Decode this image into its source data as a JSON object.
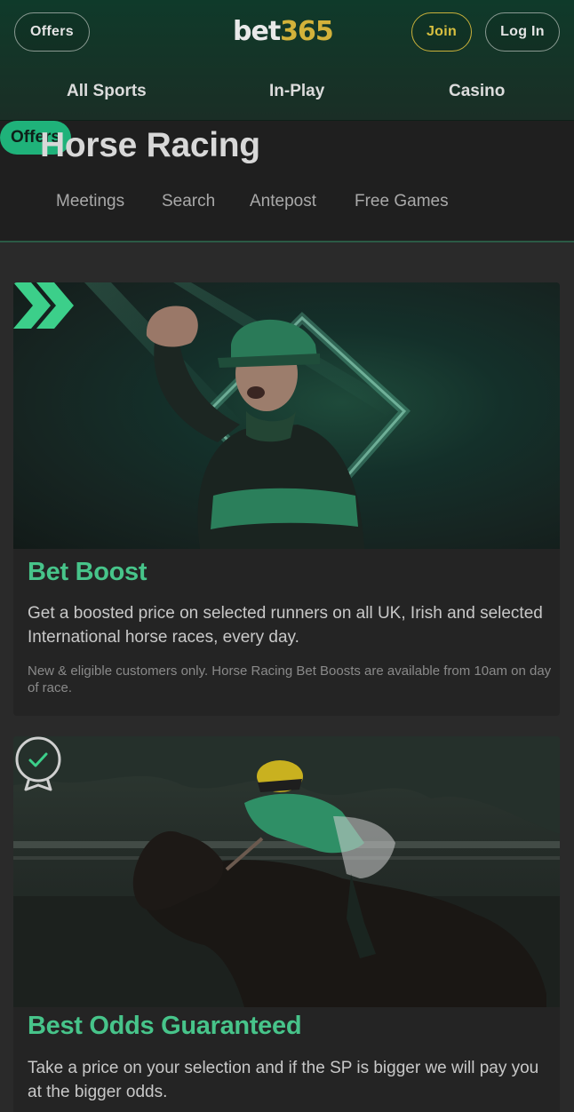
{
  "header": {
    "offers_label": "Offers",
    "logo_part1": "bet",
    "logo_part2": "365",
    "join_label": "Join",
    "login_label": "Log In",
    "nav": [
      "All Sports",
      "In-Play",
      "Casino"
    ]
  },
  "subheader": {
    "title": "Horse Racing",
    "tabs": [
      "Meetings",
      "Search",
      "Antepost",
      "Free Games",
      "Offers"
    ],
    "active_tab": "Offers"
  },
  "offers": [
    {
      "title": "Bet Boost",
      "description": "Get a boosted price on selected runners on all UK, Irish and selected International horse races, every day.",
      "terms": "New & eligible customers only. Horse Racing Bet Boosts are available from 10am on day of race.",
      "icon": "double-chevron-right-icon"
    },
    {
      "title": "Best Odds Guaranteed",
      "description": "Take a price on your selection and if the SP is bigger we will pay you at the bigger odds.",
      "icon": "badge-check-icon"
    }
  ],
  "colors": {
    "accent_green": "#1fb27a",
    "title_green": "#47c48a",
    "brand_yellow": "#d3b23a",
    "header_bg": "#163327",
    "page_bg": "#2a2a2a"
  }
}
